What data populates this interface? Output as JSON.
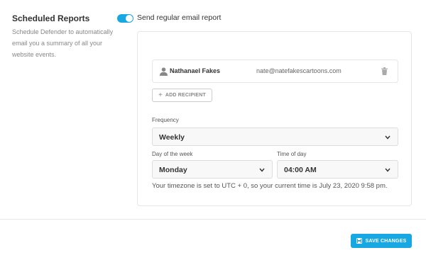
{
  "section": {
    "title": "Scheduled Reports",
    "description": "Schedule Defender to automatically email you a summary of all your website events."
  },
  "toggle": {
    "label": "Send regular email report",
    "enabled": true
  },
  "recipients": [
    {
      "name": "Nathanael Fakes",
      "email": "nate@natefakescartoons.com"
    }
  ],
  "add_recipient_label": "ADD RECIPIENT",
  "frequency": {
    "label": "Frequency",
    "value": "Weekly"
  },
  "day_of_week": {
    "label": "Day of the week",
    "value": "Monday"
  },
  "time_of_day": {
    "label": "Time of day",
    "value": "04:00 AM"
  },
  "timezone_note": "Your timezone is set to UTC + 0, so your current time is July 23, 2020 9:58 pm.",
  "save_button_label": "SAVE CHANGES",
  "colors": {
    "accent": "#17a8e3",
    "border": "#e6e6e6",
    "muted_text": "#888888"
  },
  "icons": {
    "user": "user-icon",
    "trash": "trash-icon",
    "plus": "plus-icon",
    "chevron": "chevron-down-icon",
    "save": "save-icon"
  }
}
